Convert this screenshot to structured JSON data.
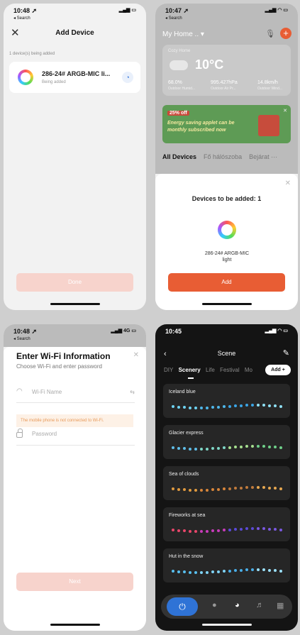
{
  "status": {
    "p1_time": "10:48 ➚",
    "p1_back": "◂ Search",
    "p1_ind": "▂▄▆ ▭",
    "p2_time": "10:47 ➚",
    "p2_back": "◂ Search",
    "p2_ind": "▂▄▆ ◠ ▭",
    "p3_time": "10:48 ➚",
    "p3_back": "◂ Search",
    "p3_ind": "▂▄▆ 4G ▭",
    "p4_time": "10:45",
    "p4_ind": "▂▄▆ ◠ ▭"
  },
  "add_device": {
    "close_icon": "✕",
    "title": "Add Device",
    "subtitle": "1 device(s) being added",
    "device_name": "286-24# ARGB-MIC li...",
    "device_status": "Being added",
    "done_label": "Done"
  },
  "home": {
    "home_label": "My Home .. ▾",
    "mic_icon": "🎙",
    "plus_icon": "+",
    "cozy_label": "Cozy Home",
    "temperature": "10°C",
    "humidity_value": "68.0%",
    "humidity_label": "Outdoor Humid...",
    "pressure_value": "995.427hPa",
    "pressure_label": "Outdoor Air Pr...",
    "wind_value": "14.8km/h",
    "wind_label": "Outdoor Wind...",
    "banner_badge": "25% off",
    "banner_text": "Energy saving applet can be monthly subscribed now",
    "banner_close": "✕",
    "tab_all": "All Devices",
    "tab_room1": "Fő hálószoba",
    "tab_room2": "Bejárat ···",
    "sheet_close": "✕",
    "sheet_title": "Devices to be added: 1",
    "sheet_device_name": "286-24# ARGB-MIC light",
    "add_label": "Add"
  },
  "wifi": {
    "close_icon": "✕",
    "title": "Enter Wi-Fi Information",
    "subtitle": "Choose Wi-Fi and enter password",
    "wifi_icon": "◠",
    "wifi_name_placeholder": "Wi-Fi Name",
    "switch_icon": "⇆",
    "warning": "The mobile phone is not connected to Wi-Fi.",
    "password_placeholder": "Password",
    "next_label": "Next"
  },
  "scene": {
    "back_icon": "‹",
    "title": "Scene",
    "edit_icon": "✎",
    "tabs": [
      "DIY",
      "Scenery",
      "Life",
      "Festival",
      "Mo"
    ],
    "add_label": "Add +",
    "items": [
      {
        "name": "Iceland blue",
        "colors": [
          "#6ed3f2",
          "#4fb7ea",
          "#3aa5e6",
          "#8fe0f5"
        ]
      },
      {
        "name": "Glacier express",
        "colors": [
          "#5fbde8",
          "#7fd6c6",
          "#a6df8f",
          "#6fd08a"
        ]
      },
      {
        "name": "Sea of clouds",
        "colors": [
          "#e09a3f",
          "#d8853a",
          "#c07a3c",
          "#e8a850"
        ]
      },
      {
        "name": "Fireworks at sea",
        "colors": [
          "#e8466a",
          "#c83cba",
          "#5a4ad8",
          "#7a58e0"
        ]
      },
      {
        "name": "Hut in the snow",
        "colors": [
          "#58bfee",
          "#7fd3f6",
          "#4aaee8",
          "#9be0fa"
        ]
      }
    ],
    "power_icon": "⏻",
    "bulb_icon": "●",
    "palette_icon": "◕",
    "music_icon": "♬",
    "grid_icon": "▦"
  }
}
